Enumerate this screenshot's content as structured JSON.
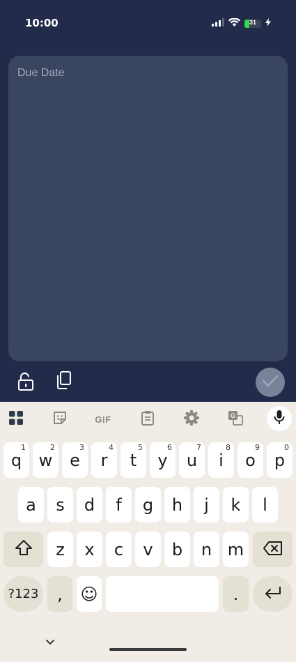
{
  "status_bar": {
    "time": "10:00",
    "battery_level": "31",
    "battery_fraction": 0.31,
    "battery_color": "#32d74b"
  },
  "note": {
    "placeholder": "Due Date",
    "value": ""
  },
  "toolbar": {
    "lock_icon": "lock-open-icon",
    "copy_icon": "copy-icon",
    "confirm_icon": "check-icon"
  },
  "keyboard": {
    "toolbar_icons": [
      "apps-grid-icon",
      "sticker-icon",
      "gif-icon",
      "clipboard-icon",
      "settings-icon",
      "translate-icon",
      "mic-icon"
    ],
    "gif_label": "GIF",
    "rows": [
      [
        {
          "label": "q",
          "hint": "1"
        },
        {
          "label": "w",
          "hint": "2"
        },
        {
          "label": "e",
          "hint": "3"
        },
        {
          "label": "r",
          "hint": "4"
        },
        {
          "label": "t",
          "hint": "5"
        },
        {
          "label": "y",
          "hint": "6"
        },
        {
          "label": "u",
          "hint": "7"
        },
        {
          "label": "i",
          "hint": "8"
        },
        {
          "label": "o",
          "hint": "9"
        },
        {
          "label": "p",
          "hint": "0"
        }
      ],
      [
        {
          "label": "a"
        },
        {
          "label": "s"
        },
        {
          "label": "d"
        },
        {
          "label": "f"
        },
        {
          "label": "g"
        },
        {
          "label": "h"
        },
        {
          "label": "j"
        },
        {
          "label": "k"
        },
        {
          "label": "l"
        }
      ],
      [
        {
          "label": "z"
        },
        {
          "label": "x"
        },
        {
          "label": "c"
        },
        {
          "label": "v"
        },
        {
          "label": "b"
        },
        {
          "label": "n"
        },
        {
          "label": "m"
        }
      ]
    ],
    "symbols_label": "?123",
    "comma_label": ",",
    "period_label": ".",
    "emoji_label": "☺"
  }
}
